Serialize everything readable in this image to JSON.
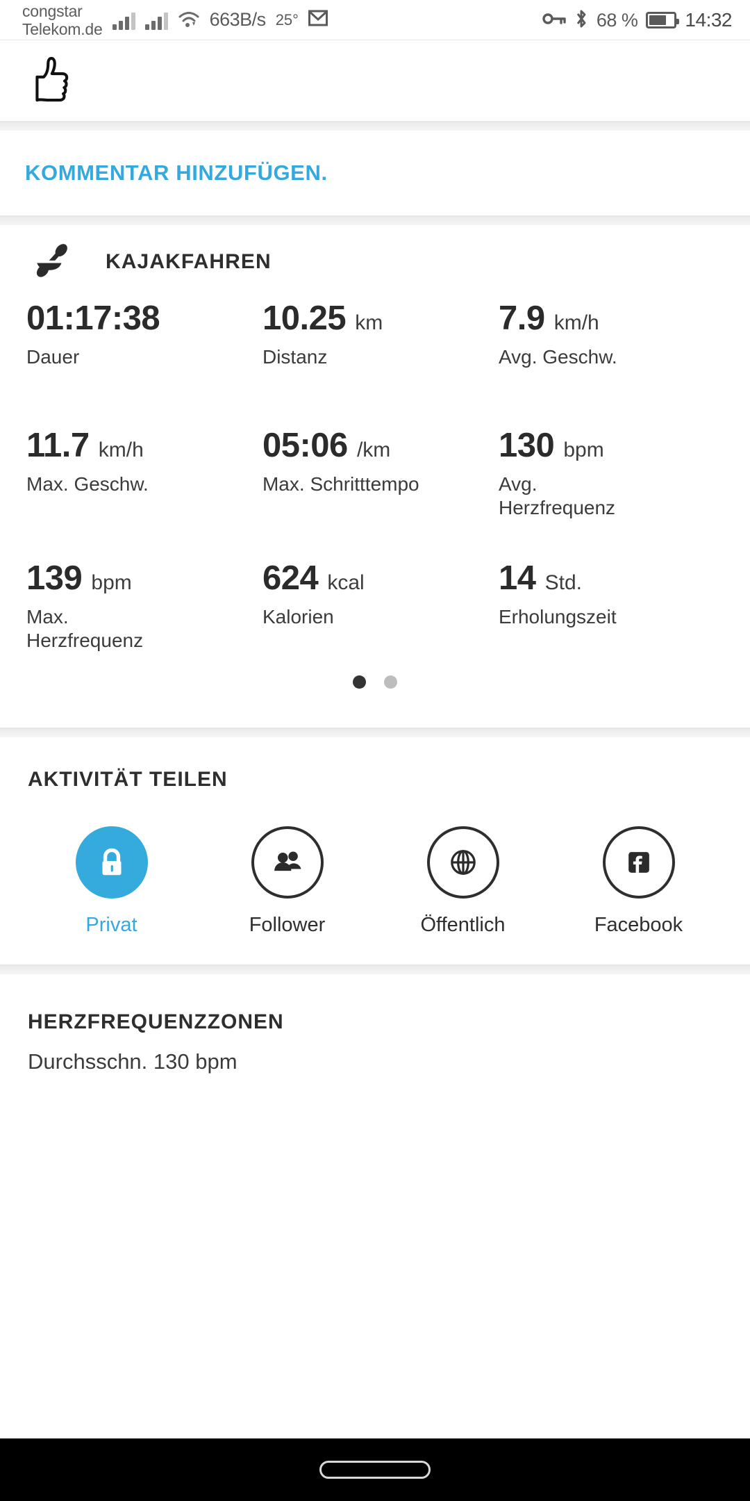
{
  "statusbar": {
    "carrier": "congstar\nTelekom.de",
    "network_speed": "663B/s",
    "temperature": "25°",
    "battery_percent": "68 %",
    "clock": "14:32",
    "icons": [
      "signal-icon",
      "signal-icon",
      "wifi-icon",
      "mail-icon",
      "vpn-key-icon",
      "bluetooth-icon",
      "battery-icon"
    ]
  },
  "like": {
    "icon": "thumbs-up-icon"
  },
  "comment": {
    "label": "KOMMENTAR HINZUFÜGEN."
  },
  "activity": {
    "icon": "kayaking-icon",
    "title": "KAJAKFAHREN",
    "stats": [
      {
        "value": "01:17:38",
        "unit": "",
        "label": "Dauer"
      },
      {
        "value": "10.25",
        "unit": "km",
        "label": "Distanz"
      },
      {
        "value": "7.9",
        "unit": "km/h",
        "label": "Avg. Geschw."
      },
      {
        "value": "11.7",
        "unit": "km/h",
        "label": "Max. Geschw."
      },
      {
        "value": "05:06",
        "unit": "/km",
        "label": "Max. Schritttempo"
      },
      {
        "value": "130",
        "unit": "bpm",
        "label": "Avg. Herzfrequenz"
      },
      {
        "value": "139",
        "unit": "bpm",
        "label": "Max. Herzfrequenz"
      },
      {
        "value": "624",
        "unit": "kcal",
        "label": "Kalorien"
      },
      {
        "value": "14",
        "unit": "Std.",
        "label": "Erholungszeit"
      }
    ],
    "pager": {
      "count": 2,
      "active_index": 0
    }
  },
  "share": {
    "title": "AKTIVITÄT TEILEN",
    "selected_index": 0,
    "options": [
      {
        "label": "Privat",
        "icon": "lock-icon"
      },
      {
        "label": "Follower",
        "icon": "people-icon"
      },
      {
        "label": "Öffentlich",
        "icon": "globe-icon"
      },
      {
        "label": "Facebook",
        "icon": "facebook-icon"
      }
    ]
  },
  "heart_rate_zones": {
    "title": "HERZFREQUENZZONEN",
    "subtitle": "Durchsschn. 130 bpm"
  },
  "colors": {
    "accent": "#35a9dd",
    "text": "#2e2e2e",
    "muted": "#3b3b3b",
    "background": "#ffffff",
    "divider": "#ededed"
  }
}
